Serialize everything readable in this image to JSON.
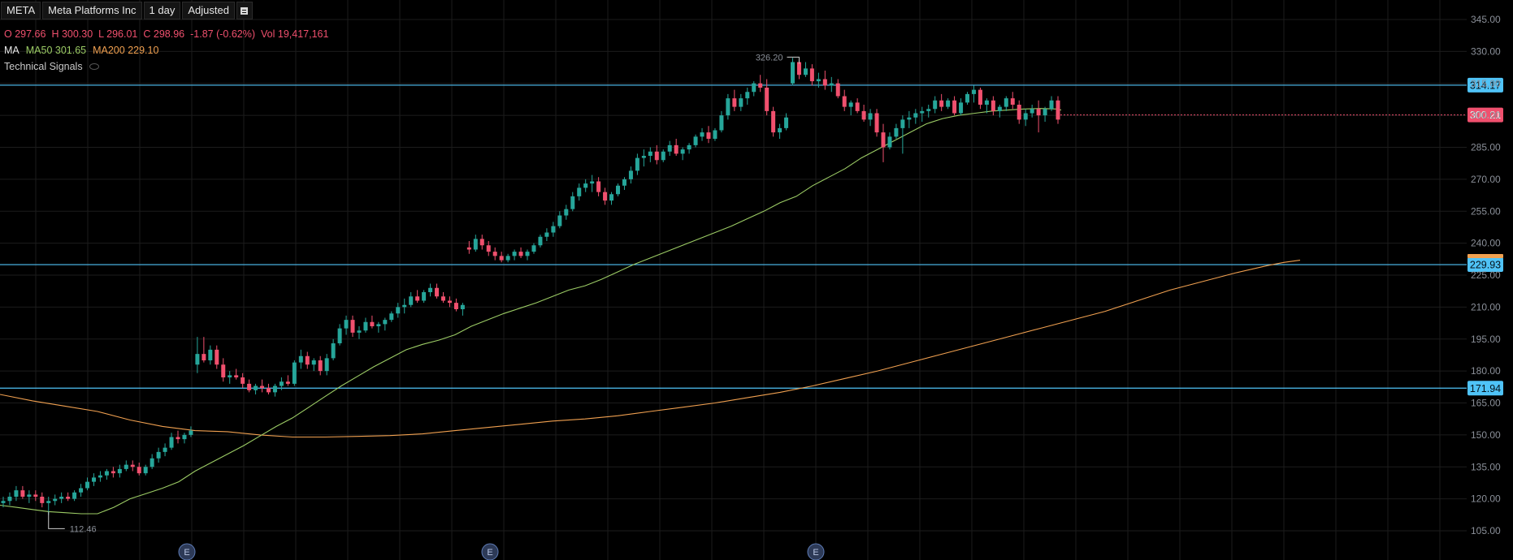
{
  "header": {
    "symbol": "META",
    "company": "Meta Platforms Inc",
    "interval": "1 day",
    "adjustment": "Adjusted",
    "menu_icon": "menu-icon"
  },
  "ohlc": {
    "open": "O 297.66",
    "high": "H 300.30",
    "low": "L 296.01",
    "close": "C 298.96",
    "change": "-1.87 (-0.62%)",
    "volume": "Vol 19,417,161"
  },
  "ma": {
    "label": "MA",
    "ma50": "MA50 301.65",
    "ma200": "MA200 229.10"
  },
  "technical_signals": "Technical Signals",
  "colors": {
    "up": "#26a69a",
    "down": "#f0506e",
    "ma50": "#9ccc65",
    "ma200": "#f0a050",
    "hline": "#4fc3f7",
    "grid": "#1c1c1c",
    "axis_text": "#8a8f98",
    "last_price": "#f0506e"
  },
  "chart_data": {
    "type": "candlestick",
    "ylim": [
      100,
      348
    ],
    "y_ticks": [
      "345.00",
      "330.00",
      "315.00",
      "300.00",
      "285.00",
      "270.00",
      "255.00",
      "240.00",
      "225.00",
      "210.00",
      "195.00",
      "180.00",
      "165.00",
      "150.00",
      "135.00",
      "120.00",
      "105.00"
    ],
    "horizontal_lines": [
      {
        "value": 314.17,
        "label": "314.17"
      },
      {
        "value": 229.93,
        "label": "229.93"
      },
      {
        "value": 171.94,
        "label": "171.94"
      }
    ],
    "last_price": {
      "value": 300.21,
      "label": "300.21"
    },
    "annotations": [
      {
        "label": "326.20",
        "value": 326.2
      },
      {
        "label": "112.46",
        "value": 112.46
      }
    ],
    "earnings_markers": [
      "E",
      "E",
      "E"
    ],
    "candles": [
      [
        118,
        121,
        116,
        119
      ],
      [
        119,
        123,
        117,
        121
      ],
      [
        121,
        126,
        119,
        124
      ],
      [
        124,
        126,
        120,
        121
      ],
      [
        121,
        124,
        118,
        122
      ],
      [
        122,
        124,
        119,
        121
      ],
      [
        121,
        123,
        116,
        118
      ],
      [
        118,
        121,
        112.46,
        119
      ],
      [
        119,
        122,
        117,
        120
      ],
      [
        120,
        123,
        118,
        121
      ],
      [
        121,
        123,
        119,
        120
      ],
      [
        120,
        124,
        119,
        123
      ],
      [
        123,
        127,
        121,
        125
      ],
      [
        125,
        130,
        124,
        128
      ],
      [
        128,
        132,
        126,
        130
      ],
      [
        130,
        133,
        128,
        131
      ],
      [
        131,
        134,
        129,
        133
      ],
      [
        133,
        135,
        130,
        132
      ],
      [
        132,
        136,
        130,
        134
      ],
      [
        134,
        138,
        133,
        136
      ],
      [
        136,
        138,
        133,
        135
      ],
      [
        135,
        137,
        131,
        132
      ],
      [
        132,
        136,
        131,
        135
      ],
      [
        135,
        141,
        134,
        139
      ],
      [
        139,
        144,
        137,
        142
      ],
      [
        142,
        146,
        140,
        144
      ],
      [
        144,
        151,
        143,
        149
      ],
      [
        149,
        152,
        146,
        148
      ],
      [
        148,
        151,
        146,
        150
      ],
      [
        150,
        154,
        149,
        152
      ],
      [
        183,
        196,
        179,
        188
      ],
      [
        188,
        196,
        184,
        185
      ],
      [
        185,
        192,
        183,
        190
      ],
      [
        190,
        192,
        181,
        183
      ],
      [
        183,
        186,
        175,
        177
      ],
      [
        177,
        180,
        174,
        178
      ],
      [
        178,
        181,
        176,
        177
      ],
      [
        177,
        179,
        172,
        174
      ],
      [
        174,
        176,
        170,
        171
      ],
      [
        171,
        174,
        169,
        173
      ],
      [
        173,
        176,
        170,
        172
      ],
      [
        172,
        174,
        169,
        170
      ],
      [
        170,
        174,
        168,
        173
      ],
      [
        173,
        177,
        171,
        175
      ],
      [
        175,
        178,
        173,
        174
      ],
      [
        174,
        185,
        173,
        184
      ],
      [
        184,
        190,
        181,
        187
      ],
      [
        187,
        189,
        181,
        183
      ],
      [
        183,
        186,
        180,
        185
      ],
      [
        185,
        187,
        178,
        180
      ],
      [
        180,
        188,
        178,
        186
      ],
      [
        186,
        195,
        185,
        193
      ],
      [
        193,
        202,
        192,
        200
      ],
      [
        200,
        206,
        197,
        204
      ],
      [
        204,
        206,
        196,
        198
      ],
      [
        198,
        201,
        195,
        199
      ],
      [
        199,
        205,
        198,
        203
      ],
      [
        203,
        206,
        200,
        201
      ],
      [
        201,
        203,
        198,
        202
      ],
      [
        202,
        205,
        199,
        204
      ],
      [
        204,
        208,
        203,
        207
      ],
      [
        207,
        212,
        205,
        210
      ],
      [
        210,
        214,
        207,
        211
      ],
      [
        211,
        217,
        210,
        215
      ],
      [
        215,
        218,
        212,
        213
      ],
      [
        213,
        218,
        212,
        217
      ],
      [
        217,
        221,
        215,
        219
      ],
      [
        219,
        221,
        214,
        215
      ],
      [
        215,
        217,
        212,
        213
      ],
      [
        213,
        215,
        210,
        212
      ],
      [
        212,
        214,
        208,
        209
      ],
      [
        209,
        212,
        206,
        211
      ],
      [
        238,
        241,
        235,
        237
      ],
      [
        237,
        244,
        236,
        242
      ],
      [
        242,
        244,
        237,
        239
      ],
      [
        239,
        241,
        234,
        236
      ],
      [
        236,
        238,
        232,
        234
      ],
      [
        234,
        236,
        231,
        232
      ],
      [
        232,
        235,
        231,
        234
      ],
      [
        234,
        237,
        232,
        236
      ],
      [
        236,
        238,
        233,
        234
      ],
      [
        234,
        237,
        232,
        236
      ],
      [
        236,
        240,
        235,
        239
      ],
      [
        239,
        244,
        238,
        243
      ],
      [
        243,
        247,
        241,
        245
      ],
      [
        245,
        250,
        243,
        248
      ],
      [
        248,
        255,
        247,
        253
      ],
      [
        253,
        258,
        251,
        256
      ],
      [
        256,
        264,
        255,
        262
      ],
      [
        262,
        268,
        260,
        266
      ],
      [
        266,
        270,
        264,
        268
      ],
      [
        268,
        272,
        264,
        269
      ],
      [
        269,
        271,
        262,
        264
      ],
      [
        264,
        266,
        258,
        260
      ],
      [
        260,
        264,
        258,
        263
      ],
      [
        263,
        268,
        262,
        267
      ],
      [
        267,
        271,
        265,
        270
      ],
      [
        270,
        276,
        268,
        274
      ],
      [
        274,
        282,
        272,
        280
      ],
      [
        280,
        284,
        276,
        281
      ],
      [
        281,
        285,
        278,
        283
      ],
      [
        283,
        286,
        277,
        279
      ],
      [
        279,
        284,
        278,
        283
      ],
      [
        283,
        288,
        281,
        286
      ],
      [
        286,
        289,
        281,
        282
      ],
      [
        282,
        285,
        279,
        284
      ],
      [
        284,
        287,
        282,
        286
      ],
      [
        286,
        291,
        285,
        290
      ],
      [
        290,
        294,
        288,
        292
      ],
      [
        292,
        295,
        287,
        289
      ],
      [
        289,
        294,
        288,
        293
      ],
      [
        293,
        302,
        292,
        300
      ],
      [
        300,
        310,
        298,
        308
      ],
      [
        308,
        312,
        302,
        304
      ],
      [
        304,
        310,
        302,
        308
      ],
      [
        308,
        313,
        305,
        311
      ],
      [
        311,
        316,
        309,
        315
      ],
      [
        315,
        319,
        311,
        313
      ],
      [
        313,
        317,
        300,
        302
      ],
      [
        302,
        304,
        290,
        292
      ],
      [
        292,
        296,
        289,
        294
      ],
      [
        294,
        301,
        293,
        299
      ],
      [
        315,
        327,
        314,
        325
      ],
      [
        325,
        326.2,
        317,
        319
      ],
      [
        319,
        325,
        318,
        322
      ],
      [
        322,
        324,
        314,
        316
      ],
      [
        316,
        320,
        313,
        317
      ],
      [
        317,
        321,
        312,
        314
      ],
      [
        314,
        318,
        311,
        315
      ],
      [
        315,
        317,
        308,
        309
      ],
      [
        309,
        312,
        302,
        304
      ],
      [
        304,
        307,
        300,
        306
      ],
      [
        306,
        308,
        301,
        302
      ],
      [
        302,
        305,
        297,
        298
      ],
      [
        298,
        303,
        295,
        301
      ],
      [
        301,
        303,
        290,
        292
      ],
      [
        292,
        296,
        278,
        285
      ],
      [
        285,
        292,
        284,
        290
      ],
      [
        290,
        296,
        289,
        294
      ],
      [
        294,
        300,
        282,
        298
      ],
      [
        298,
        302,
        294,
        299
      ],
      [
        299,
        303,
        296,
        301
      ],
      [
        301,
        304,
        297,
        302
      ],
      [
        302,
        305,
        299,
        303
      ],
      [
        303,
        309,
        301,
        307
      ],
      [
        307,
        310,
        302,
        304
      ],
      [
        304,
        308,
        303,
        307
      ],
      [
        307,
        309,
        300,
        301
      ],
      [
        301,
        308,
        300,
        306
      ],
      [
        306,
        311,
        305,
        310
      ],
      [
        310,
        314,
        306,
        312
      ],
      [
        312,
        313,
        303,
        305
      ],
      [
        305,
        308,
        301,
        307
      ],
      [
        307,
        309,
        300,
        302
      ],
      [
        302,
        305,
        299,
        304
      ],
      [
        304,
        309,
        302,
        308
      ],
      [
        308,
        311,
        303,
        305
      ],
      [
        305,
        307,
        296,
        298
      ],
      [
        298,
        303,
        295,
        301
      ],
      [
        301,
        305,
        299,
        303
      ],
      [
        303,
        307,
        292,
        300
      ],
      [
        300,
        304,
        297,
        303
      ],
      [
        303,
        309,
        302,
        307
      ],
      [
        307,
        309,
        296,
        298
      ]
    ],
    "ma50": [
      [
        0,
        117
      ],
      [
        20,
        116
      ],
      [
        40,
        115
      ],
      [
        60,
        114
      ],
      [
        80,
        113.5
      ],
      [
        100,
        113
      ],
      [
        120,
        113
      ],
      [
        140,
        116
      ],
      [
        160,
        120
      ],
      [
        180,
        122.5
      ],
      [
        200,
        125
      ],
      [
        220,
        128
      ],
      [
        240,
        133
      ],
      [
        260,
        137
      ],
      [
        280,
        141
      ],
      [
        300,
        145
      ],
      [
        320,
        149.5
      ],
      [
        340,
        154
      ],
      [
        360,
        158
      ],
      [
        380,
        163
      ],
      [
        400,
        168
      ],
      [
        420,
        173
      ],
      [
        440,
        177.5
      ],
      [
        460,
        182
      ],
      [
        480,
        186
      ],
      [
        500,
        190
      ],
      [
        520,
        192.5
      ],
      [
        540,
        194.5
      ],
      [
        560,
        197
      ],
      [
        580,
        201
      ],
      [
        600,
        204
      ],
      [
        620,
        207
      ],
      [
        640,
        209.5
      ],
      [
        660,
        212
      ],
      [
        680,
        215
      ],
      [
        700,
        218
      ],
      [
        720,
        220
      ],
      [
        740,
        223
      ],
      [
        760,
        226.5
      ],
      [
        780,
        230
      ],
      [
        800,
        233
      ],
      [
        820,
        236
      ],
      [
        840,
        239
      ],
      [
        860,
        242
      ],
      [
        880,
        245
      ],
      [
        900,
        248
      ],
      [
        920,
        251.5
      ],
      [
        940,
        255
      ],
      [
        960,
        259
      ],
      [
        980,
        262
      ],
      [
        1000,
        267
      ],
      [
        1020,
        271
      ],
      [
        1040,
        275
      ],
      [
        1060,
        280
      ],
      [
        1080,
        284
      ],
      [
        1100,
        288
      ],
      [
        1120,
        292
      ],
      [
        1140,
        296
      ],
      [
        1160,
        298.5
      ],
      [
        1180,
        300
      ],
      [
        1200,
        301
      ],
      [
        1220,
        302
      ],
      [
        1240,
        302.5
      ],
      [
        1260,
        303
      ],
      [
        1280,
        303.2
      ],
      [
        1300,
        303
      ],
      [
        1306,
        302.5
      ]
    ],
    "ma200": [
      [
        0,
        169
      ],
      [
        40,
        166
      ],
      [
        80,
        163.5
      ],
      [
        120,
        161
      ],
      [
        160,
        157
      ],
      [
        200,
        154
      ],
      [
        240,
        152
      ],
      [
        280,
        151.5
      ],
      [
        320,
        150
      ],
      [
        360,
        149
      ],
      [
        400,
        149
      ],
      [
        440,
        149.3
      ],
      [
        480,
        149.7
      ],
      [
        520,
        150.5
      ],
      [
        560,
        152
      ],
      [
        600,
        153.5
      ],
      [
        640,
        155
      ],
      [
        680,
        156.5
      ],
      [
        720,
        157.5
      ],
      [
        760,
        159
      ],
      [
        800,
        161
      ],
      [
        840,
        163
      ],
      [
        880,
        165
      ],
      [
        920,
        167.5
      ],
      [
        960,
        170
      ],
      [
        1000,
        173
      ],
      [
        1040,
        176.5
      ],
      [
        1080,
        180
      ],
      [
        1120,
        184
      ],
      [
        1160,
        188
      ],
      [
        1200,
        192
      ],
      [
        1240,
        196
      ],
      [
        1280,
        200
      ],
      [
        1320,
        204
      ],
      [
        1360,
        208
      ],
      [
        1400,
        213
      ],
      [
        1440,
        218
      ],
      [
        1480,
        222
      ],
      [
        1520,
        226
      ],
      [
        1560,
        229.5
      ],
      [
        1580,
        231
      ],
      [
        1600,
        232
      ]
    ]
  }
}
